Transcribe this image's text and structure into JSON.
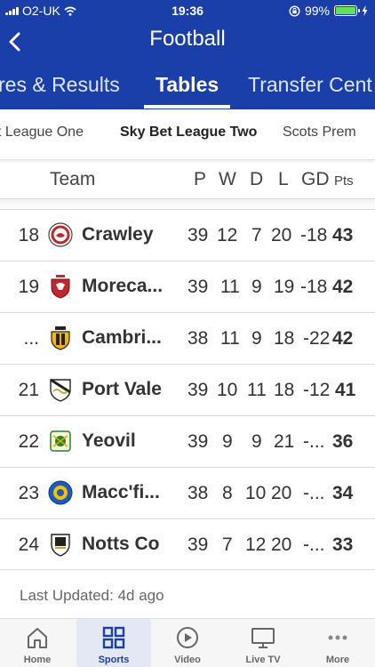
{
  "status": {
    "carrier": "O2-UK",
    "time": "19:36",
    "battery": "99%",
    "battery_level": 0.99
  },
  "header": {
    "title": "Football",
    "tabs": [
      {
        "label": "res & Results"
      },
      {
        "label": "Tables"
      },
      {
        "label": "Transfer Cent"
      }
    ]
  },
  "leagues": [
    {
      "label": "t League One"
    },
    {
      "label": "Sky Bet League Two"
    },
    {
      "label": "Scots Prem"
    }
  ],
  "table": {
    "columns": {
      "team": "Team",
      "p": "P",
      "w": "W",
      "d": "D",
      "l": "L",
      "gd": "GD",
      "pts": "Pts"
    },
    "rows": [
      {
        "pos": "18",
        "team": "Crawley",
        "p": "39",
        "w": "12",
        "d": "7",
        "l": "20",
        "gd": "-18",
        "pts": "43",
        "badge": "crawley-badge-icon"
      },
      {
        "pos": "19",
        "team": "Moreca...",
        "p": "39",
        "w": "11",
        "d": "9",
        "l": "19",
        "gd": "-18",
        "pts": "42",
        "badge": "morecambe-badge-icon"
      },
      {
        "pos": "...",
        "team": "Cambri...",
        "p": "38",
        "w": "11",
        "d": "9",
        "l": "18",
        "gd": "-22",
        "pts": "42",
        "badge": "cambridge-badge-icon"
      },
      {
        "pos": "21",
        "team": "Port Vale",
        "p": "39",
        "w": "10",
        "d": "11",
        "l": "18",
        "gd": "-12",
        "pts": "41",
        "badge": "port-vale-badge-icon"
      },
      {
        "pos": "22",
        "team": "Yeovil",
        "p": "39",
        "w": "9",
        "d": "9",
        "l": "21",
        "gd": "-...",
        "pts": "36",
        "badge": "yeovil-badge-icon"
      },
      {
        "pos": "23",
        "team": "Macc'fi...",
        "p": "38",
        "w": "8",
        "d": "10",
        "l": "20",
        "gd": "-...",
        "pts": "34",
        "badge": "macclesfield-badge-icon"
      },
      {
        "pos": "24",
        "team": "Notts Co",
        "p": "39",
        "w": "7",
        "d": "12",
        "l": "20",
        "gd": "-...",
        "pts": "33",
        "badge": "notts-county-badge-icon"
      }
    ]
  },
  "last_updated": "Last Updated: 4d ago",
  "nav": [
    {
      "label": "Home",
      "icon": "home-icon"
    },
    {
      "label": "Sports",
      "icon": "grid-icon"
    },
    {
      "label": "Video",
      "icon": "play-icon"
    },
    {
      "label": "Live TV",
      "icon": "tv-icon"
    },
    {
      "label": "More",
      "icon": "more-icon"
    }
  ],
  "colors": {
    "brand": "#1b3fa8",
    "battery": "#5ee35a"
  }
}
